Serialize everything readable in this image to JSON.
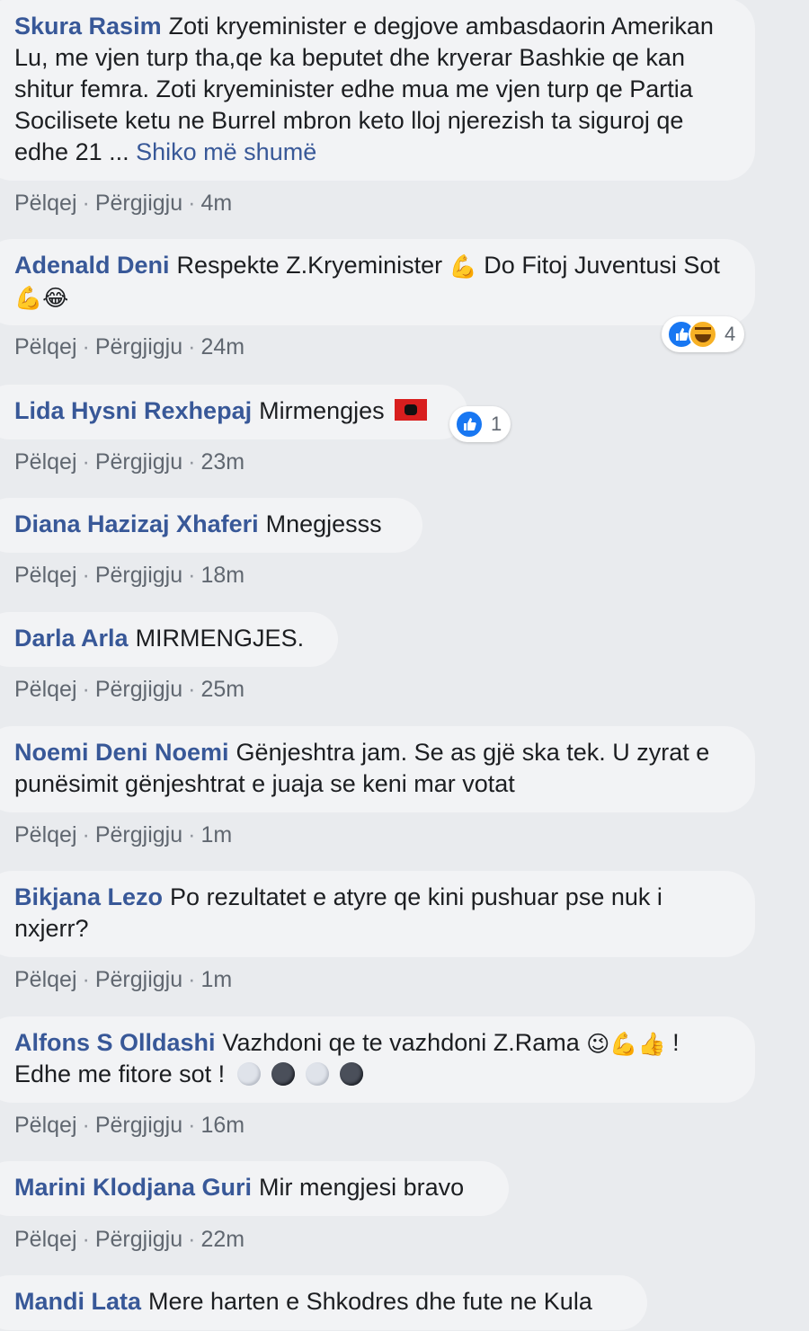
{
  "actions": {
    "like": "Pëlqej",
    "reply": "Përgjigju",
    "separator": "·"
  },
  "comments": [
    {
      "author": "Skura Rasim",
      "text": "Zoti kryeminister e degjove ambasdaorin Amerikan Lu, me vjen turp tha,qe ka beputet dhe kryerar Bashkie qe kan shitur femra. Zoti kryeminister edhe mua me vjen turp qe Partia Socilisete ketu ne Burrel mbron keto lloj njerezish ta siguroj qe edhe 21 ...",
      "more": "Shiko më shumë",
      "time": "4m"
    },
    {
      "author": "Adenald Deni",
      "text": "Respekte Z.Kryeminister",
      "emoji1": "💪",
      "text2": "Do Fitoj Juventusi Sot",
      "emoji2": "💪😂",
      "reaction_count": "4",
      "reaction_icons": [
        "like-icon",
        "haha-icon"
      ],
      "time": "24m"
    },
    {
      "author": "Lida Hysni Rexhepaj",
      "text": "Mirmengjes",
      "reaction_count": "1",
      "reaction_icons": [
        "like-icon"
      ],
      "time": "23m"
    },
    {
      "author": "Diana Hazizaj Xhaferi",
      "text": "Mnegjesss",
      "time": "18m"
    },
    {
      "author": "Darla Arla",
      "text": "MIRMENGJES.",
      "time": "25m"
    },
    {
      "author": "Noemi Deni Noemi",
      "text": "Gënjeshtra jam. Se as gjë ska tek. U zyrat e punësimit gënjeshtrat e juaja se keni mar votat",
      "time": "1m"
    },
    {
      "author": "Bikjana Lezo",
      "text": "Po rezultatet e atyre qe kini pushuar pse nuk i nxjerr?",
      "time": "1m"
    },
    {
      "author": "Alfons S Olldashi",
      "text": "Vazhdoni qe te vazhdoni Z.Rama",
      "emoji1": "😉💪👍",
      "text2": "! Edhe me fitore sot !",
      "time": "16m"
    },
    {
      "author": "Marini Klodjana Guri",
      "text": "Mir mengjesi bravo",
      "time": "22m"
    },
    {
      "author": "Mandi Lata",
      "text": "Mere harten e Shkodres dhe fute ne Kula"
    }
  ],
  "colors": {
    "background": "#e9ebee",
    "bubble": "#f2f3f5",
    "author": "#385898",
    "meta": "#606770",
    "like": "#1877f2"
  }
}
